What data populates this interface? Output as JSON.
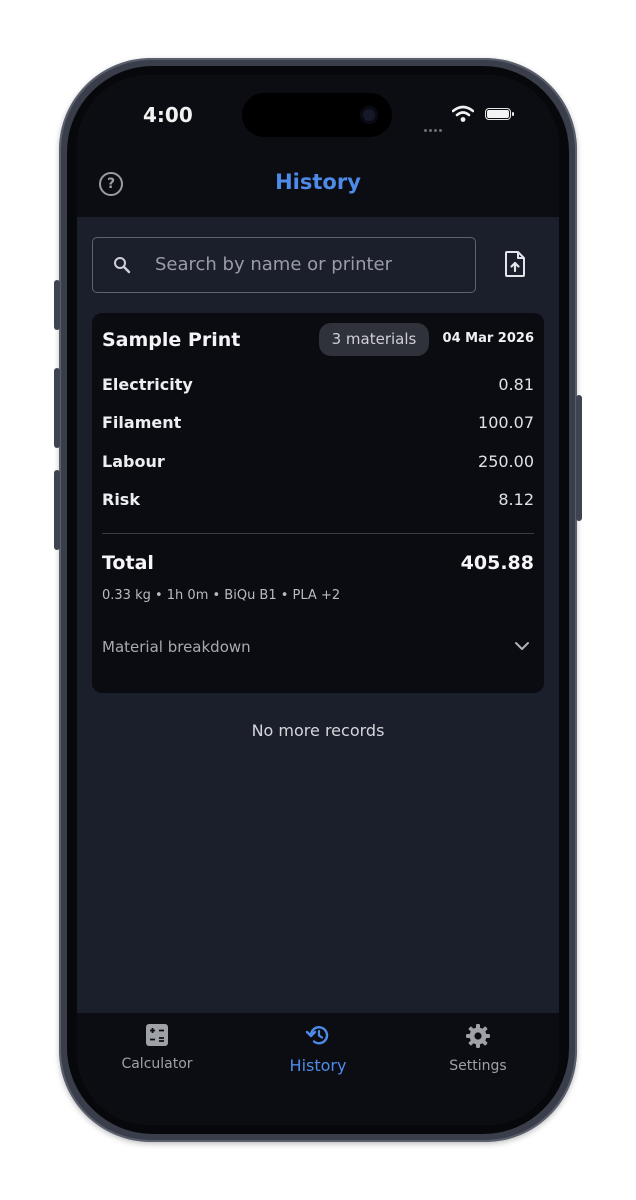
{
  "status_bar": {
    "time": "4:00"
  },
  "header": {
    "title": "History",
    "help_icon": "help-circle-icon",
    "help_glyph": "?"
  },
  "search": {
    "placeholder": "Search by name or printer",
    "export_icon": "file-upload-icon"
  },
  "record": {
    "name": "Sample Print",
    "materials_badge": "3 materials",
    "date": "04 Mar 2026",
    "lines": [
      {
        "label": "Electricity",
        "value": "0.81"
      },
      {
        "label": "Filament",
        "value": "100.07"
      },
      {
        "label": "Labour",
        "value": "250.00"
      },
      {
        "label": "Risk",
        "value": "8.12"
      }
    ],
    "total_label": "Total",
    "total_value": "405.88",
    "meta": "0.33 kg • 1h 0m • BiQu B1 • PLA +2",
    "breakdown_label": "Material breakdown"
  },
  "footer_text": "No more records",
  "tabs": [
    {
      "label": "Calculator",
      "icon": "calculator-icon",
      "active": false
    },
    {
      "label": "History",
      "icon": "history-icon",
      "active": true
    },
    {
      "label": "Settings",
      "icon": "gear-icon",
      "active": false
    }
  ],
  "colors": {
    "accent": "#4e8be8",
    "background": "#1b1e2b",
    "card": "#0b0c11",
    "bar": "#0c0d12"
  }
}
